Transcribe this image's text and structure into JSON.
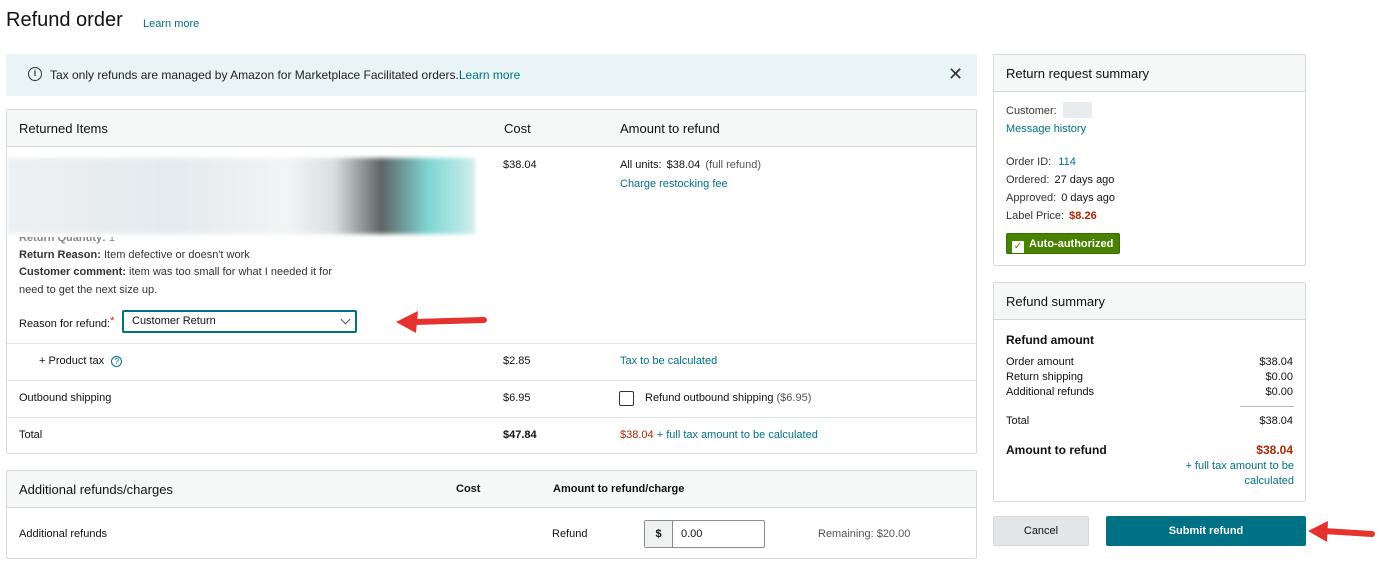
{
  "header": {
    "title": "Refund order",
    "learn_more": "Learn more"
  },
  "banner": {
    "icon": "info-icon",
    "text": "Tax only refunds are managed by Amazon for Marketplace Facilitated orders.",
    "link": "Learn more"
  },
  "items_table": {
    "headers": {
      "item": "Returned Items",
      "cost": "Cost",
      "amount": "Amount to refund"
    },
    "item": {
      "quantity_label": "Return Quantity:",
      "quantity": "1",
      "reason_label": "Return Reason:",
      "reason": "Item defective or doesn't work",
      "comment_label": "Customer comment:",
      "comment_line1": "item was too small for what I needed it for",
      "comment_line2": "need to get the next size up.",
      "refund_reason_label": "Reason for refund:",
      "refund_reason_value": "Customer Return",
      "cost": "$38.04",
      "all_units_label": "All units:",
      "all_units_value": "$38.04",
      "full_refund": "(full refund)",
      "restocking_link": "Charge restocking fee"
    },
    "tax": {
      "label": "+ Product tax",
      "cost": "$2.85",
      "amount": "Tax to be calculated"
    },
    "shipping": {
      "label": "Outbound shipping",
      "cost": "$6.95",
      "checkbox_label": "Refund outbound shipping",
      "checkbox_amount": "($6.95)"
    },
    "total": {
      "label": "Total",
      "cost": "$47.84",
      "amount": "$38.04",
      "amount_suffix": "+ full tax amount to be calculated"
    }
  },
  "additional": {
    "headers": {
      "title": "Additional refunds/charges",
      "cost": "Cost",
      "amount": "Amount to refund/charge"
    },
    "row": {
      "label": "Additional refunds",
      "type": "Refund",
      "currency": "$",
      "value": "0.00",
      "remaining": "Remaining: $20.00"
    }
  },
  "return_summary": {
    "title": "Return request summary",
    "customer_label": "Customer:",
    "message_history": "Message history",
    "order_id_label": "Order ID:",
    "order_id": "114",
    "ordered_label": "Ordered:",
    "ordered": "27 days ago",
    "approved_label": "Approved:",
    "approved": "0 days ago",
    "label_price_label": "Label Price:",
    "label_price": "$8.26",
    "badge": "Auto-authorized"
  },
  "refund_summary": {
    "title": "Refund summary",
    "refund_amount_heading": "Refund amount",
    "rows": [
      {
        "label": "Order amount",
        "value": "$38.04"
      },
      {
        "label": "Return shipping",
        "value": "$0.00"
      },
      {
        "label": "Additional refunds",
        "value": "$0.00"
      }
    ],
    "total_label": "Total",
    "total_value": "$38.04",
    "amount_to_refund_label": "Amount to refund",
    "amount_to_refund_value": "$38.04",
    "tax_note_line1": "+ full tax amount to be",
    "tax_note_line2": "calculated"
  },
  "actions": {
    "cancel": "Cancel",
    "submit": "Submit refund"
  },
  "colors": {
    "link": "#007185",
    "price_red": "#b12704",
    "badge_green": "#488201",
    "arrow_red": "#e5322d"
  }
}
